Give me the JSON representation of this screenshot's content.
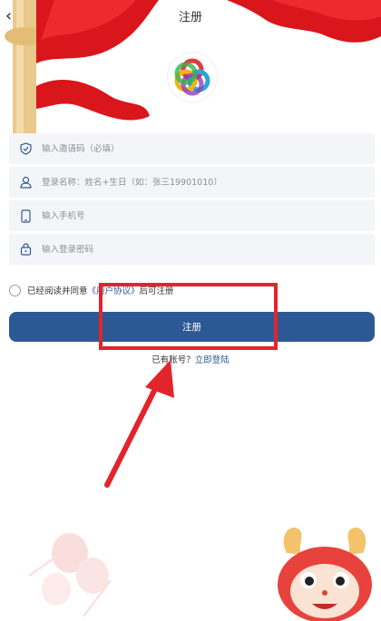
{
  "header": {
    "title": "注册",
    "back_icon": "chevron-left-icon"
  },
  "form": {
    "invite_placeholder": "输入邀请码（必填）",
    "username_placeholder": "登录名称：姓名+生日（如：张三19901010）",
    "phone_placeholder": "输入手机号",
    "password_placeholder": "输入登录密码"
  },
  "agreement": {
    "prefix": "已经阅读并同意",
    "link": "《用户协议》",
    "suffix": "后可注册"
  },
  "buttons": {
    "register": "注册"
  },
  "footer": {
    "has_account": "已有账号？",
    "login_link": "立即登陆"
  },
  "colors": {
    "accent": "#2c5993",
    "annotation": "#e3242b",
    "flag": "#d9161c"
  }
}
